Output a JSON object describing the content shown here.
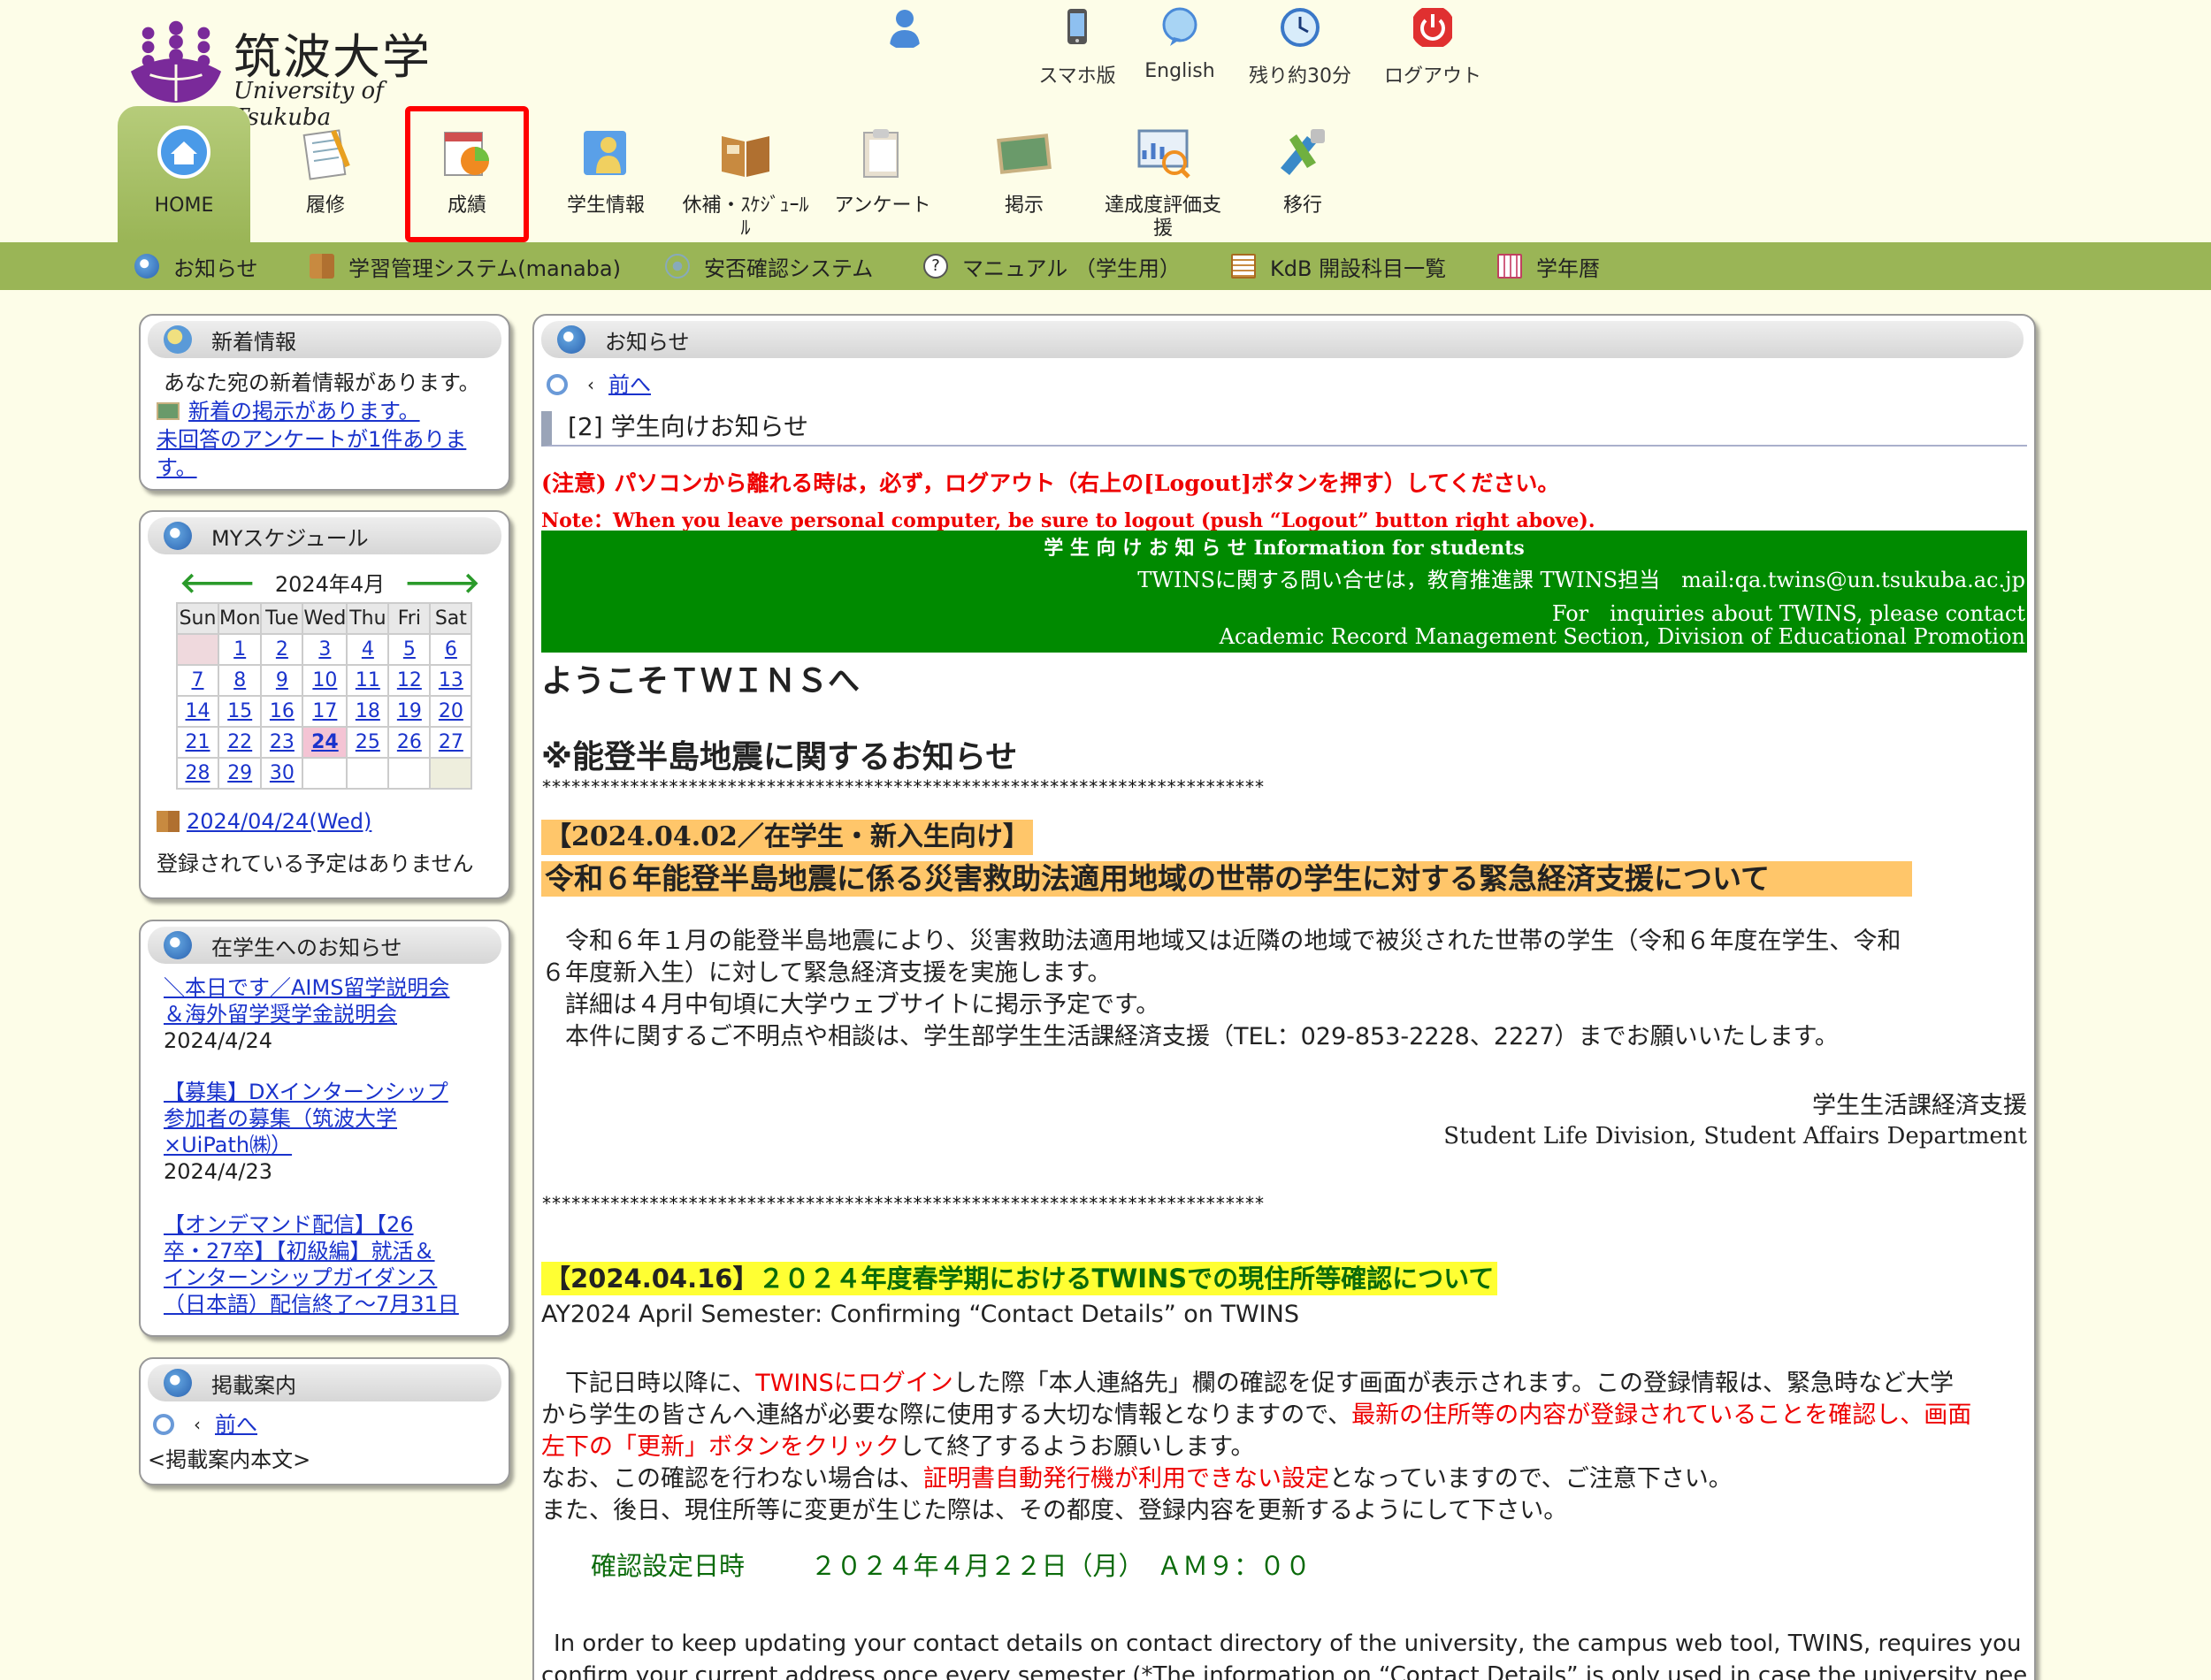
{
  "logo": {
    "jp": "筑波大学",
    "en": "University of Tsukuba"
  },
  "util": [
    {
      "label": "",
      "icon": "person-icon"
    },
    {
      "label": "スマホ版",
      "icon": "smartphone-icon"
    },
    {
      "label": "English",
      "icon": "speech-bubble-icon"
    },
    {
      "label": "残り約30分",
      "icon": "clock-icon"
    },
    {
      "label": "ログアウト",
      "icon": "power-icon"
    }
  ],
  "nav": [
    {
      "label": "HOME",
      "icon": "home-icon"
    },
    {
      "label": "履修",
      "icon": "notepad-icon"
    },
    {
      "label": "成績",
      "icon": "grades-chart-icon"
    },
    {
      "label": "学生情報",
      "icon": "student-info-icon"
    },
    {
      "label": "休補・ｽｹｼﾞｭｰﾙ",
      "icon": "schedule-book-icon"
    },
    {
      "label": "アンケート",
      "icon": "clipboard-icon"
    },
    {
      "label": "掲示",
      "icon": "bulletin-board-icon"
    },
    {
      "label": "達成度評価支援",
      "icon": "evaluation-icon"
    },
    {
      "label": "移行",
      "icon": "migration-tools-icon"
    }
  ],
  "subnav": [
    {
      "label": "お知らせ",
      "icon": "info-icon"
    },
    {
      "label": "学習管理システム(manaba)",
      "icon": "manaba-icon"
    },
    {
      "label": "安否確認システム",
      "icon": "signal-icon"
    },
    {
      "label": "マニュアル （学生用）",
      "icon": "help-icon"
    },
    {
      "label": "KdB 開設科目一覧",
      "icon": "list-icon"
    },
    {
      "label": "学年暦",
      "icon": "calendar-icon"
    }
  ],
  "news": {
    "title": "新着情報",
    "intro": "あなた宛の新着情報があります。",
    "link1": "新着の掲示があります。",
    "link2a": "未回答のアンケートが1件ありま",
    "link2b": "す。"
  },
  "schedule": {
    "title": "MYスケジュール",
    "month": "2024年4月",
    "weekdays": [
      "Sun",
      "Mon",
      "Tue",
      "Wed",
      "Thu",
      "Fri",
      "Sat"
    ],
    "weeks": [
      [
        "",
        "1",
        "2",
        "3",
        "4",
        "5",
        "6"
      ],
      [
        "7",
        "8",
        "9",
        "10",
        "11",
        "12",
        "13"
      ],
      [
        "14",
        "15",
        "16",
        "17",
        "18",
        "19",
        "20"
      ],
      [
        "21",
        "22",
        "23",
        "24",
        "25",
        "26",
        "27"
      ],
      [
        "28",
        "29",
        "30",
        "",
        "",
        "",
        ""
      ]
    ],
    "today": "24",
    "date_link": "2024/04/24(Wed)",
    "no_events": "登録されている予定はありません"
  },
  "notices": {
    "title": "在学生へのお知らせ",
    "items": [
      {
        "l1": "＼本日です／AIMS留学説明会",
        "l2": "＆海外留学奨学金説明会",
        "l3": "",
        "date": "2024/4/24"
      },
      {
        "l1": "【募集】DXインターンシップ",
        "l2": "参加者の募集（筑波大学",
        "l3": "×UiPath㈱）",
        "date": "2024/4/23"
      },
      {
        "l1": "【オンデマンド配信】【26",
        "l2": "卒・27卒】【初級編】就活＆",
        "l3": "インターンシップガイダンス",
        "l4": "（日本語）配信終了～7月31日",
        "date": ""
      }
    ]
  },
  "guide": {
    "title": "掲載案内",
    "prev": "前へ",
    "body": "<掲載案内本文>"
  },
  "main": {
    "title": "お知らせ",
    "prev": "前へ",
    "category": "[2]  学生向けお知らせ",
    "warn_jp": "(注意) パソコンから離れる時は，必ず，ログアウト（右上の[Logout]ボタンを押す）してください。",
    "warn_en": "Note：When you leave personal computer, be sure to logout (push “Logout” button right above).",
    "green_title": "学 生 向 け お 知 ら せ  Information for students",
    "green_contact_jp": "TWINSに関する問い合せは，教育推進課 TWINS担当　mail:qa.twins@un.tsukuba.ac.jp",
    "green_contact_en1": "For　inquiries about TWINS, please contact",
    "green_contact_en2": "Academic Record Management Section, Division of Educational Promotion",
    "welcome": "ようこそＴＷＩＮＳへ",
    "quake_heading": "※能登半島地震に関するお知らせ",
    "stars": "**************************************************************************",
    "band1": "【2024.04.02／在学生・新入生向け】",
    "band2": "令和６年能登半島地震に係る災害救助法適用地域の世帯の学生に対する緊急経済支援について",
    "para1a": "　令和６年１月の能登半島地震により、災害救助法適用地域又は近隣の地域で被災された世帯の学生（令和６年度在学生、令和",
    "para1b": "６年度新入生）に対して緊急経済支援を実施します。",
    "para1c": "　詳細は４月中旬頃に大学ウェブサイトに掲示予定です。",
    "para1d": "　本件に関するご不明点や相談は、学生部学生生活課経済支援（TEL：029-853-2228、2227）までお願いいたします。",
    "sign_jp": "学生生活課経済支援",
    "sign_en": "Student Life Division, Student Affairs Department",
    "stars2": "**************************************************************************",
    "band3_date": "【2024.04.16】",
    "band3_title": "２０２４年度春学期におけるTWINSでの現住所等確認について",
    "band3_en": "AY2024 April Semester: Confirming “Contact Details” on TWINS",
    "p2_1a": "　下記日時以降に、",
    "p2_1b": "TWINSにログイン",
    "p2_1c": "した際「本人連絡先」欄の確認を促す画面が表示されます。この登録情報は、緊急時など大学",
    "p2_2a": "から学生の皆さんへ連絡が必要な際に使用する大切な情報となりますので、",
    "p2_2b": "最新の住所等の内容が登録されていることを確認し、画面",
    "p2_3a": "左下の「更新」ボタンをクリック",
    "p2_3b": "して終了するようお願いします。",
    "p2_4a": "なお、この確認を行わない場合は、",
    "p2_4b": "証明書自動発行機が利用できない設定",
    "p2_4c": "となっていますので、ご注意下さい。",
    "p2_5": "また、後日、現住所等に変更が生じた際は、その都度、登録内容を更新するようにして下さい。",
    "confirm_label": "確認設定日時",
    "confirm_value": "２０２４年４月２２日（月）　ＡＭ９：００",
    "en1": "In order to keep updating your contact details on contact directory of the university, the campus web tool, TWINS, requires you to",
    "en2": "confirm your current address once every semester (*The information on “Contact Details” is only used in case the university needs to"
  },
  "colors": {
    "page_bg": "#fdfde8",
    "nav_green": "#9ab556",
    "banner_green": "#008a00",
    "highlight_red": "#ff0000",
    "orange_band": "#ffc66a",
    "yellow_band": "#ffff33"
  }
}
